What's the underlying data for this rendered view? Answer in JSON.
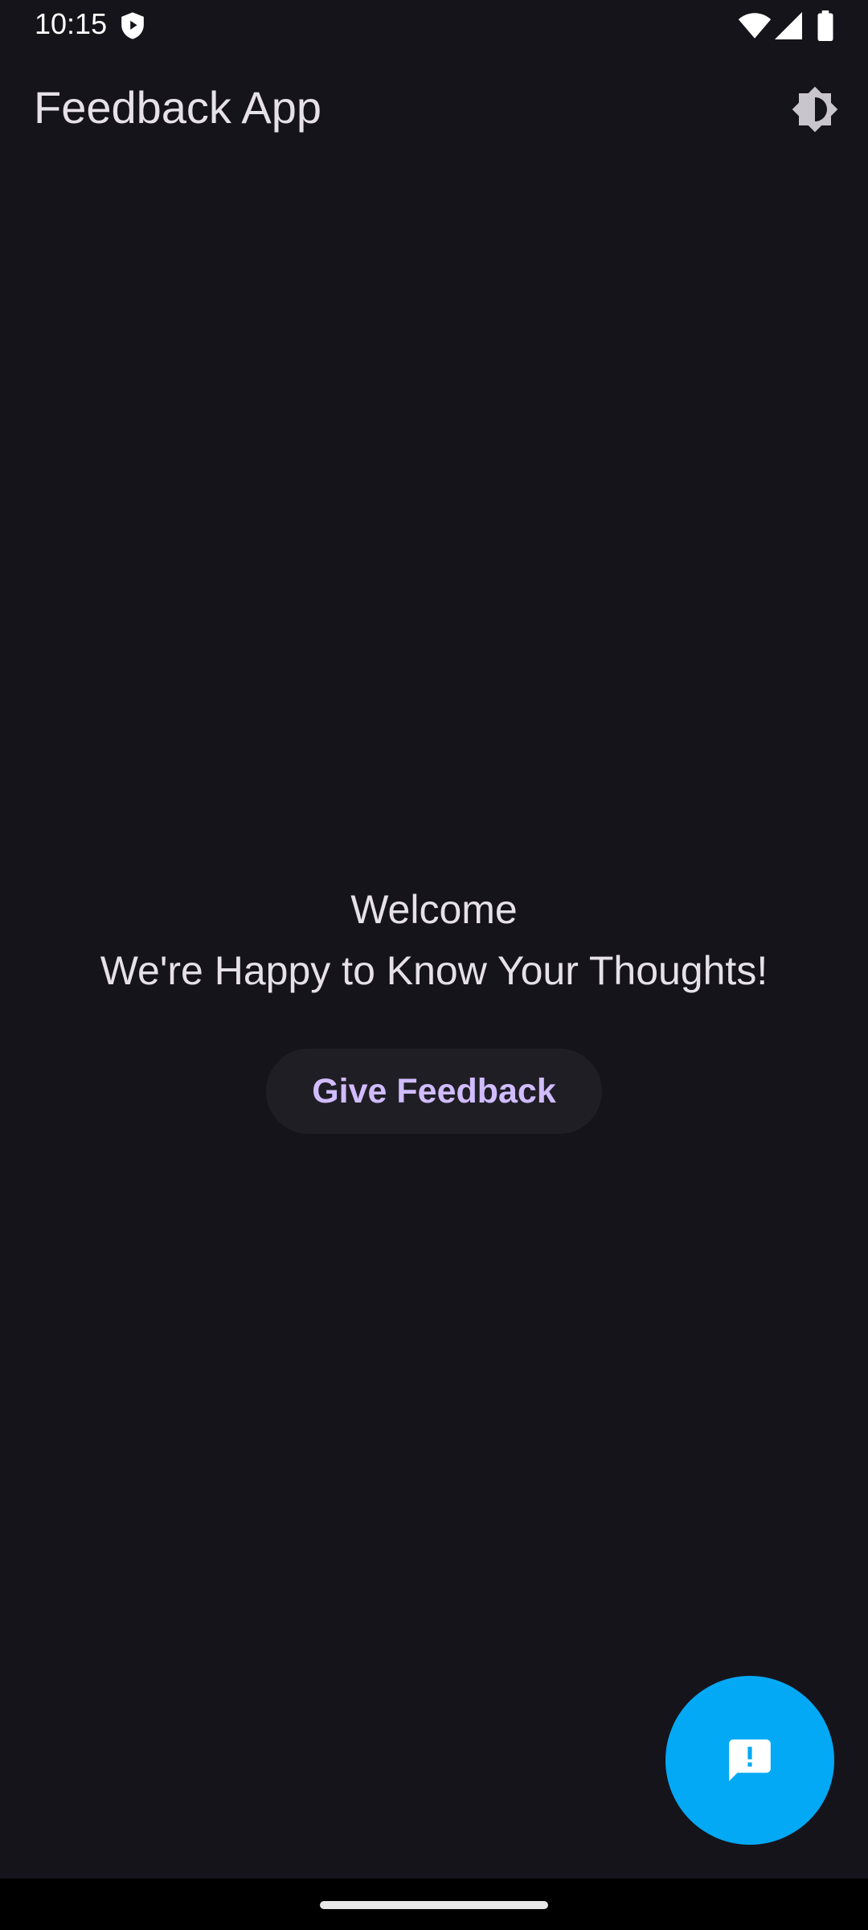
{
  "status_bar": {
    "time": "10:15",
    "icons": [
      "shield-icon",
      "wifi-icon",
      "signal-icon",
      "battery-icon"
    ]
  },
  "app_bar": {
    "title": "Feedback App",
    "action_icon": "brightness-icon"
  },
  "main": {
    "welcome": "Welcome",
    "subtitle": "We're Happy to Know Your Thoughts!",
    "give_feedback_label": "Give Feedback"
  },
  "fab": {
    "icon": "feedback-icon"
  },
  "colors": {
    "background": "#16141b",
    "text": "#e6e1e9",
    "button_background": "#201e25",
    "button_text": "#d0bcff",
    "fab": "#03a9f4",
    "nav_bar": "#000000"
  }
}
